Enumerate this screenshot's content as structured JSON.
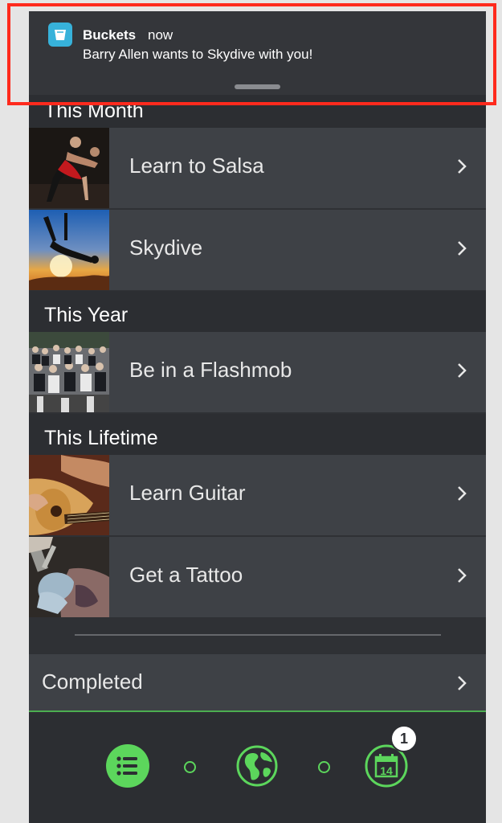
{
  "notification": {
    "app_name": "Buckets",
    "time": "now",
    "message": "Barry Allen wants to Skydive with you!"
  },
  "sections": [
    {
      "title": "This Month",
      "items": [
        {
          "label": "Learn to Salsa"
        },
        {
          "label": "Skydive"
        }
      ]
    },
    {
      "title": "This Year",
      "items": [
        {
          "label": "Be in a Flashmob"
        }
      ]
    },
    {
      "title": "This Lifetime",
      "items": [
        {
          "label": "Learn Guitar"
        },
        {
          "label": "Get a Tattoo"
        }
      ]
    }
  ],
  "completed": {
    "label": "Completed"
  },
  "tabbar": {
    "tabs": [
      "list-icon",
      "globe-icon",
      "calendar-icon"
    ],
    "calendar_day": "14",
    "badge_count": "1",
    "accent_color": "#5cd65c"
  },
  "highlight_color": "#ff2a1d"
}
